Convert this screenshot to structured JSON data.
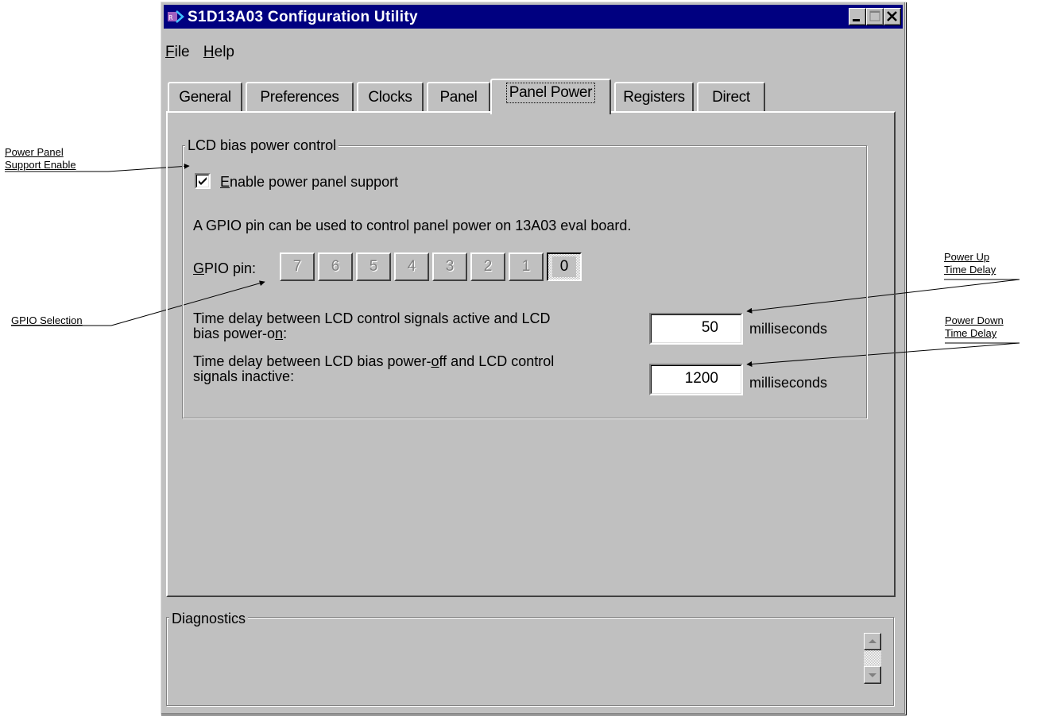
{
  "window": {
    "title": "S1D13A03 Configuration Utility",
    "app_icon": "app-logo-icon",
    "title_bar_color": "#000080",
    "controls": [
      "minimize-icon",
      "maximize-icon",
      "close-icon"
    ]
  },
  "menu": {
    "items": [
      {
        "label": "File",
        "mnemonic": "F",
        "rest": "ile"
      },
      {
        "label": "Help",
        "mnemonic": "H",
        "rest": "elp"
      }
    ]
  },
  "tabs": [
    {
      "label": "General",
      "active": false
    },
    {
      "label": "Preferences",
      "active": false
    },
    {
      "label": "Clocks",
      "active": false
    },
    {
      "label": "Panel",
      "active": false
    },
    {
      "label": "Panel Power",
      "active": true
    },
    {
      "label": "Registers",
      "active": false
    },
    {
      "label": "Direct",
      "active": false
    }
  ],
  "lcd_group": {
    "title": "LCD bias power control",
    "enable_checkbox": {
      "mnemonic": "E",
      "rest": "nable power panel support",
      "checked": true
    },
    "info_text": "A GPIO pin can be used to control panel power on 13A03 eval board.",
    "gpio": {
      "label_mnemonic": "G",
      "label_rest": "PIO pin:",
      "pins": [
        "7",
        "6",
        "5",
        "4",
        "3",
        "2",
        "1",
        "0"
      ],
      "selected": "0"
    },
    "power_on_delay": {
      "label_line1": "Time delay between LCD control signals active and LCD",
      "label_line2_pre": "bias power-o",
      "label_line2_mnemonic": "n",
      "label_line2_post": ":",
      "value": "50",
      "unit": "milliseconds"
    },
    "power_off_delay": {
      "label_line1_pre": "Time delay between LCD bias power-",
      "label_line1_mnemonic": "o",
      "label_line1_post": "ff and LCD control",
      "label_line2": "signals inactive:",
      "value": "1200",
      "unit": "milliseconds"
    }
  },
  "diagnostics": {
    "title": "Diagnostics",
    "scroll_icons": [
      "scroll-up-icon",
      "scroll-down-icon"
    ]
  },
  "annotations": {
    "power_panel_support_enable": [
      "Power Panel",
      "Support Enable"
    ],
    "gpio_selection": "GPIO Selection",
    "power_up_time_delay": [
      "Power Up",
      "Time Delay"
    ],
    "power_down_time_delay": [
      "Power Down",
      "Time Delay"
    ]
  }
}
